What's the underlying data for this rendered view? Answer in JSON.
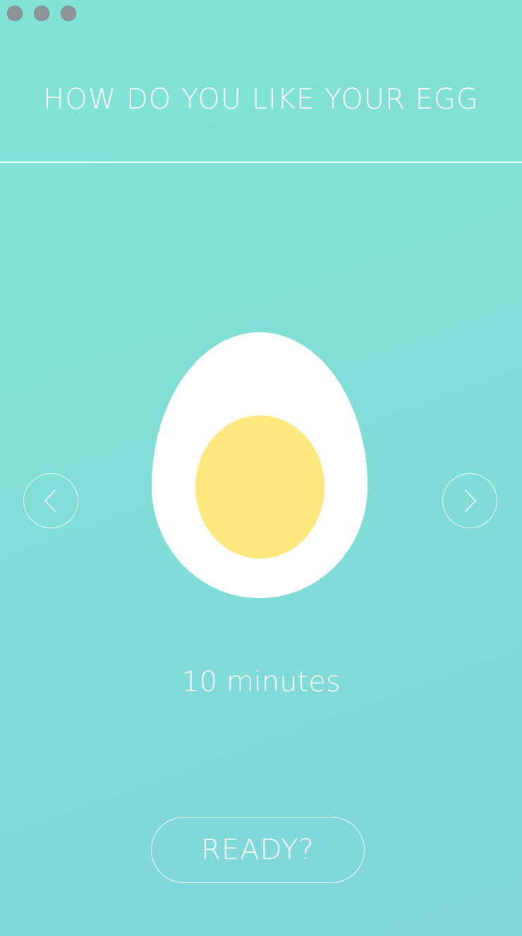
{
  "window": {
    "controls": [
      "close",
      "minimize",
      "zoom"
    ]
  },
  "header": {
    "title": "HOW DO YOU LIKE YOUR EGG"
  },
  "egg": {
    "white_color": "#ffffff",
    "yolk_color": "#fee77c"
  },
  "navigation": {
    "prev_icon": "chevron-left-icon",
    "next_icon": "chevron-right-icon"
  },
  "selection": {
    "time_label": "10 minutes"
  },
  "actions": {
    "ready_label": "READY?"
  },
  "colors": {
    "background_start": "#80e3d6",
    "background_end": "#80d6d9",
    "foreground": "#ffffff"
  }
}
